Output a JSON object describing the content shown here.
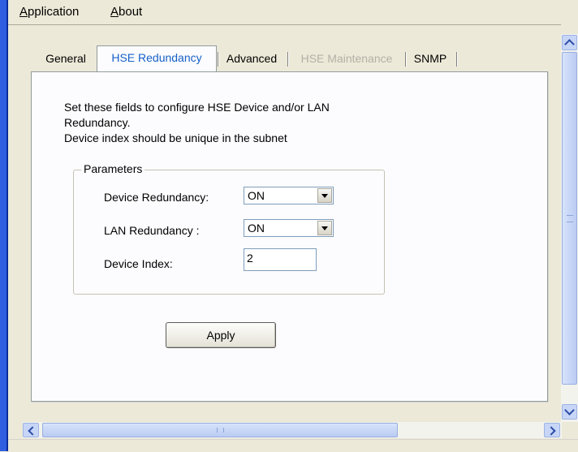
{
  "menu": {
    "application": {
      "mnemonic": "A",
      "rest": "pplication"
    },
    "about": {
      "mnemonic": "A",
      "rest": "bout"
    }
  },
  "tabs": [
    {
      "label": "General",
      "state": "normal"
    },
    {
      "label": "HSE Redundancy",
      "state": "selected"
    },
    {
      "label": "Advanced",
      "state": "normal"
    },
    {
      "label": "HSE Maintenance",
      "state": "disabled"
    },
    {
      "label": "SNMP",
      "state": "normal"
    }
  ],
  "panel": {
    "description_line1": "Set these fields to configure HSE Device and/or LAN",
    "description_line2": "Redundancy.",
    "description_line3": "Device index should be unique in the subnet",
    "group_title": "Parameters",
    "device_redundancy_label": "Device Redundancy:",
    "device_redundancy_value": "ON",
    "lan_redundancy_label": "LAN Redundancy :",
    "lan_redundancy_value": "ON",
    "device_index_label": "Device Index:",
    "device_index_value": "2",
    "apply_label": "Apply"
  },
  "colors": {
    "selected_tab_text": "#1560C8",
    "disabled_tab_text": "#B3B0A6",
    "window_face": "#ECE9D8"
  }
}
